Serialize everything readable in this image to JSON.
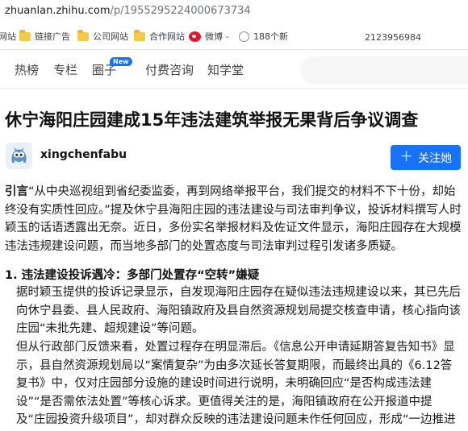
{
  "browser": {
    "url_host": "zhuanlan.zhihu.com",
    "url_path": "/p/1955295224000673734",
    "bookmarks": [
      "网站",
      "链接广告",
      "公司网站",
      "合作网站",
      "微博 -",
      "188个新"
    ],
    "extra_text": "2123956984"
  },
  "nav": {
    "items": [
      "热榜",
      "专栏",
      "圈子",
      "付费咨询",
      "知学堂"
    ],
    "new_badge": "New"
  },
  "article": {
    "title": "休宁海阳庄园建成15年违法建筑举报无果背后争议调查",
    "author": "xingchenfabu",
    "follow_label": "关注她",
    "intro_label": "引言",
    "intro_text": "“从中央巡视组到省纪委监委，再到网络举报平台，我们提交的材料不下十份，却始终没有实质性回应。”提及休宁县海阳庄园的违法建设与司法审判争议，投诉材料撰写人时颖玉的话语透露出无奈。近日，多份实名举报材料及佐证文件显示，海阳庄园存在大规模违法违规建设问题，而当地多部门的处置态度与司法审判过程引发诸多质疑。",
    "section1_title": "1. 违法建设投诉遇冷：多部门处置存“空转”嫌疑",
    "section1_p1": "据时颖玉提供的投诉记录显示，自发现海阳庄园存在疑似违法违规建设以来，其已先后向休宁县委、县人民政府、海阳镇政府及县自然资源规划局提交核查申请，核心指向该庄园“未批先建、超规建设”等问题。",
    "section1_p2": "但从行政部门反馈来看，处置过程存在明显滞后。《信息公开申请延期答复告知书》显示，县自然资源规划局以“案情复杂”为由多次延长答复期限，而最终出具的《6.12答复书》中，仅对庄园部分设施的建设时间进行说明，未明确回应“是否构成违法建设”“是否需依法处置”等核心诉求。更值得关注的是，海阳镇政府在公开报道中提及“庄园投资升级项目”，却对群众反映的违法建设问题未作任何回应，形成“一边推进项目、一边回"
  }
}
